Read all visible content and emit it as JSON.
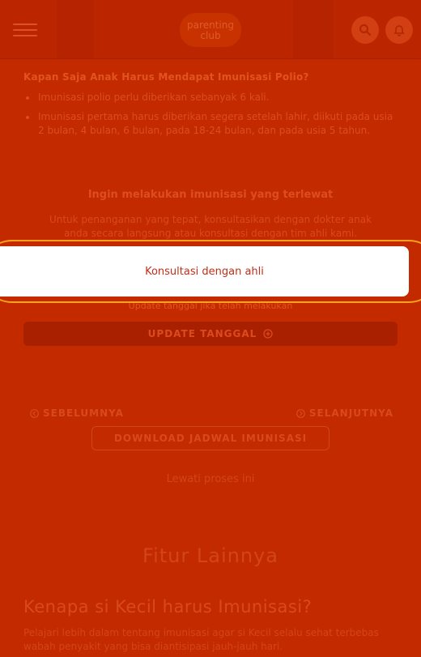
{
  "header": {
    "logo_line1": "parenting",
    "logo_line2": "club",
    "menu_icon": "hamburger-menu-icon",
    "search_icon": "search-icon",
    "notification_icon": "bell-icon"
  },
  "faq": {
    "question": "Kapan Saja Anak Harus Mendapat Imunisasi Polio?",
    "bullets": [
      "Imunisasi polio perlu diberikan sebanyak 6 kali.",
      "Imunisasi pertama harus diberikan segera setelah lahir, diikuti pada usia 2 bulan, 4 bulan, 6 bulan, pada 18-24 bulan, dan pada usia 5 tahun."
    ]
  },
  "late": {
    "title": "Ingin melakukan imunisasi yang terlewat",
    "description": "Untuk penanganan yang tepat, konsultasikan dengan dokter anak anda secara langsung atau konsultasi dengan tim ahli kami."
  },
  "modal": {
    "link_label": "Konsultasi dengan ahli"
  },
  "update": {
    "hint": "Update tanggal jika telah melakukan",
    "button_label": "UPDATE TANGGAL"
  },
  "navigation": {
    "prev_label": "SEBELUMNYA",
    "next_label": "SELANJUTNYA"
  },
  "download": {
    "label": "DOWNLOAD JADWAL IMUNISASI"
  },
  "skip": {
    "label": "Lewati proses ini"
  },
  "more_features": {
    "title": "Fitur Lainnya"
  },
  "why": {
    "title": "Kenapa si Kecil harus Imunisasi?",
    "description": "Pelajari lebih dalam tentang imunisasi agar si Kecil selalu sehat terbebas wabah penyakit yang bisa diantisipasi jauh-jauh hari."
  },
  "colors": {
    "overlay_bg": "#c42a00",
    "modal_bg": "#ffffff",
    "accent_ring": "#f6a21a",
    "link": "#c42d18"
  }
}
